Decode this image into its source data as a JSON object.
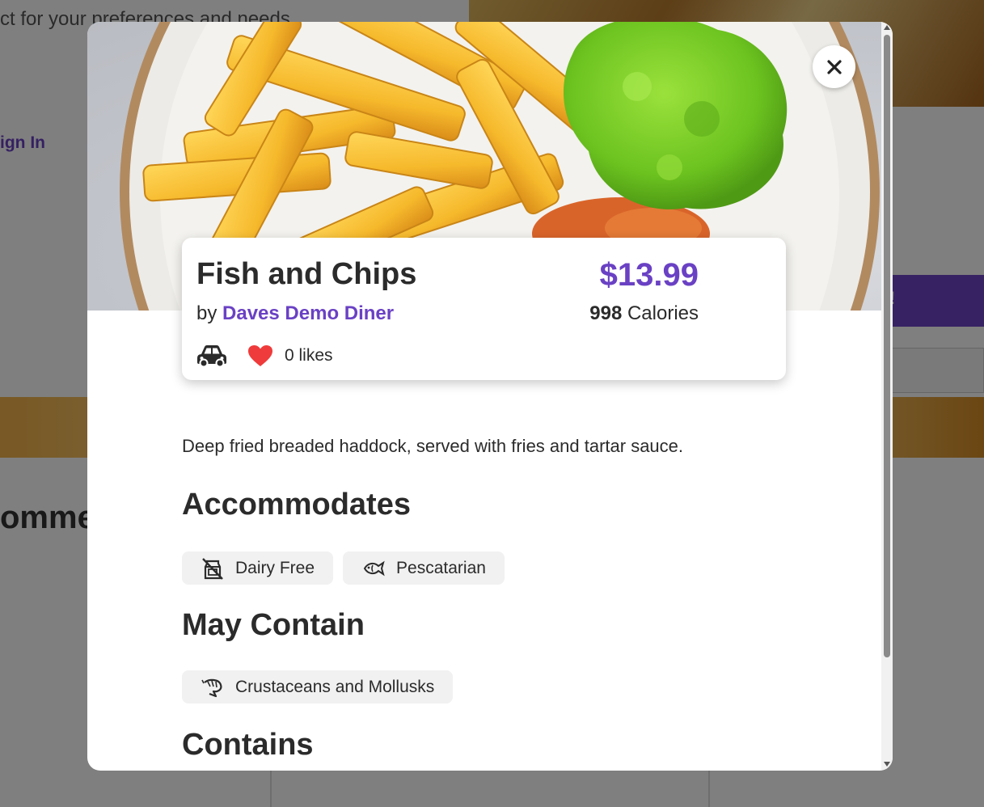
{
  "background": {
    "tagline": "ct for your preferences and needs",
    "sign_in": "ign In",
    "button_fragment": "!",
    "section_heading": "omme"
  },
  "modal": {
    "close_icon": "close-icon",
    "dish": {
      "title": "Fish and Chips",
      "by": "by",
      "restaurant": "Daves Demo Diner",
      "price": "$13.99",
      "calories_value": "998",
      "calories_unit": "Calories",
      "delivery_icon": "car-icon",
      "likes_icon": "heart-icon",
      "likes": "0 likes"
    },
    "description": "Deep fried breaded haddock, served with fries and tartar sauce.",
    "accommodates": {
      "heading": "Accommodates",
      "items": [
        {
          "label": "Dairy Free",
          "icon": "no-dairy-icon"
        },
        {
          "label": "Pescatarian",
          "icon": "fish-icon"
        }
      ]
    },
    "may_contain": {
      "heading": "May Contain",
      "items": [
        {
          "label": "Crustaceans and Mollusks",
          "icon": "shrimp-icon"
        }
      ]
    },
    "contains": {
      "heading": "Contains"
    }
  },
  "colors": {
    "accent": "#6a41c4",
    "heart": "#ef3b3b",
    "chip_bg": "#f1f1f1",
    "text": "#2b2b2b"
  }
}
